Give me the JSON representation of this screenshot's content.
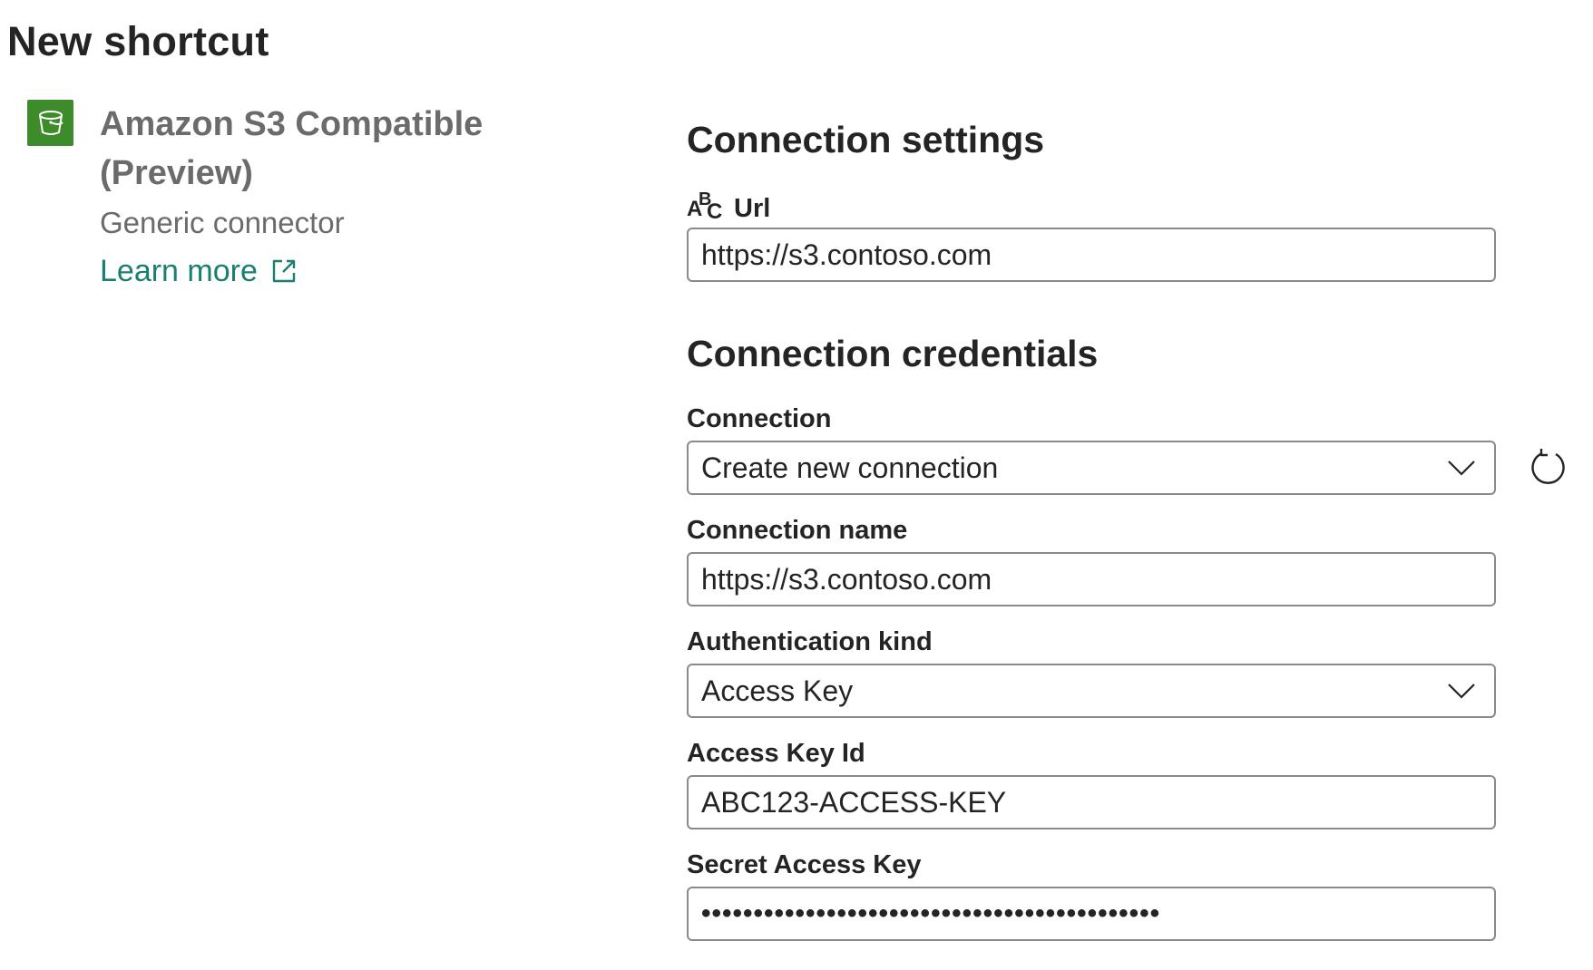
{
  "page": {
    "title": "New shortcut"
  },
  "connector": {
    "icon": "bucket-icon",
    "name": "Amazon S3 Compatible (Preview)",
    "subtitle": "Generic connector",
    "learn_more_label": "Learn more",
    "accent_color": "#3d8b2b",
    "link_color": "#1a7f6e"
  },
  "settings": {
    "section_title": "Connection settings",
    "url": {
      "label": "Url",
      "value": "https://s3.contoso.com"
    }
  },
  "credentials": {
    "section_title": "Connection credentials",
    "connection": {
      "label": "Connection",
      "selected": "Create new connection"
    },
    "connection_name": {
      "label": "Connection name",
      "value": "https://s3.contoso.com"
    },
    "auth_kind": {
      "label": "Authentication kind",
      "selected": "Access Key"
    },
    "access_key_id": {
      "label": "Access Key Id",
      "value": "ABC123-ACCESS-KEY"
    },
    "secret_access_key": {
      "label": "Secret Access Key",
      "masked_value": "••••••••••••••••••••••••••••••••••••••••••••"
    }
  }
}
